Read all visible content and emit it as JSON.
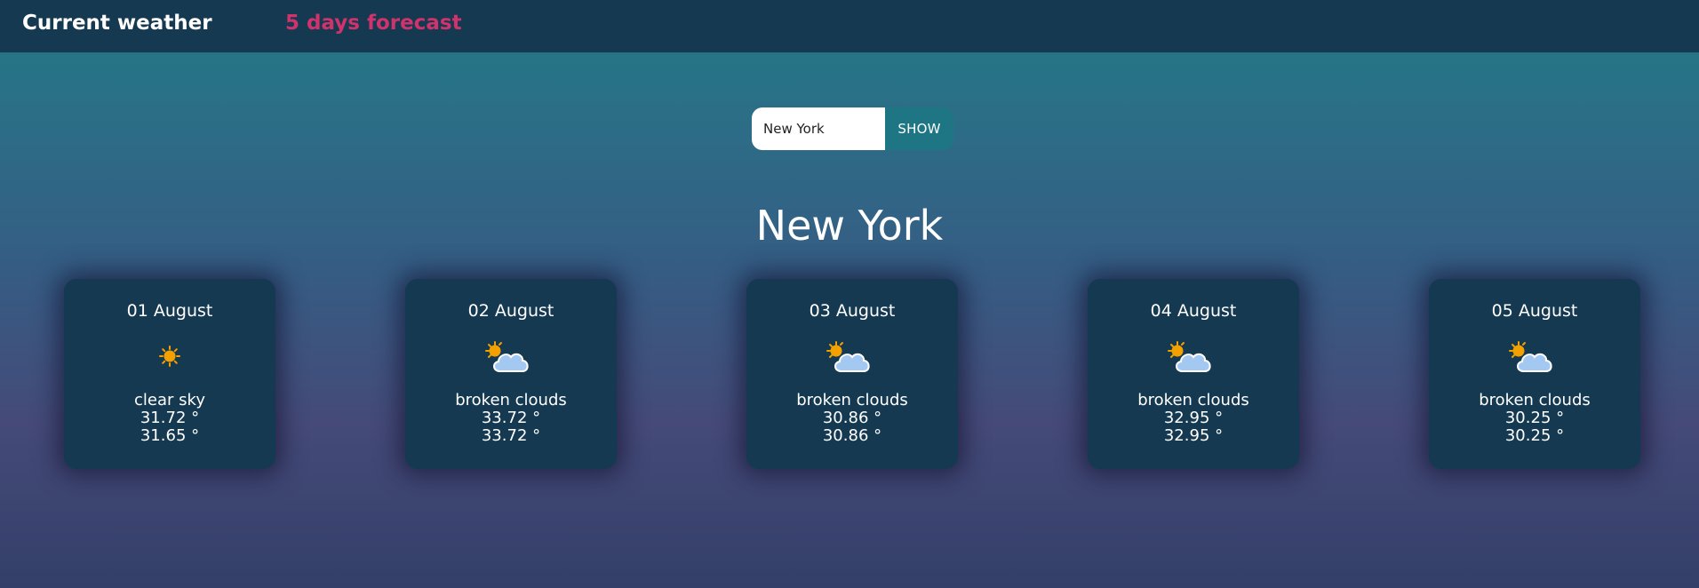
{
  "nav": {
    "current_weather": "Current weather",
    "five_days_forecast": "5 days forecast"
  },
  "search": {
    "value": "New York",
    "button_label": "SHOW"
  },
  "city": "New York",
  "colors": {
    "navbar": "#143951",
    "accent_pink": "#d0336c",
    "card": "#143951",
    "button": "#1e7684"
  },
  "forecast": [
    {
      "date": "01 August",
      "icon": "sun-icon",
      "description": "clear sky",
      "temp1": "31.72 °",
      "temp2": "31.65 °"
    },
    {
      "date": "02 August",
      "icon": "partly-cloudy-icon",
      "description": "broken clouds",
      "temp1": "33.72 °",
      "temp2": "33.72 °"
    },
    {
      "date": "03 August",
      "icon": "partly-cloudy-icon",
      "description": "broken clouds",
      "temp1": "30.86 °",
      "temp2": "30.86 °"
    },
    {
      "date": "04 August",
      "icon": "partly-cloudy-icon",
      "description": "broken clouds",
      "temp1": "32.95 °",
      "temp2": "32.95 °"
    },
    {
      "date": "05 August",
      "icon": "partly-cloudy-icon",
      "description": "broken clouds",
      "temp1": "30.25 °",
      "temp2": "30.25 °"
    }
  ]
}
